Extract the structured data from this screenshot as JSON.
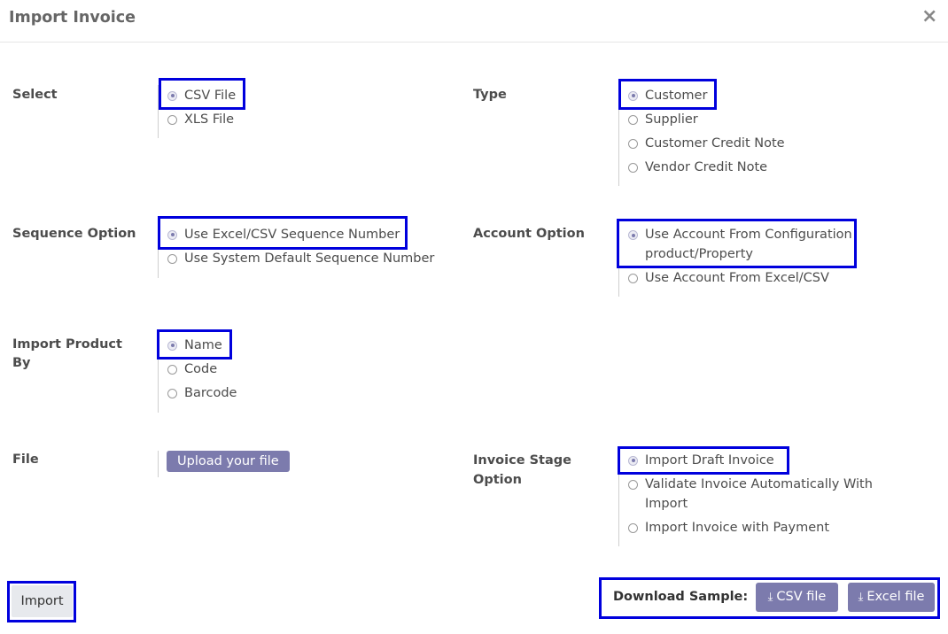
{
  "dialog": {
    "title": "Import Invoice",
    "close_glyph": "×"
  },
  "select": {
    "label": "Select",
    "options": [
      "CSV File",
      "XLS File"
    ],
    "selected": "CSV File"
  },
  "type": {
    "label": "Type",
    "options": [
      "Customer",
      "Supplier",
      "Customer Credit Note",
      "Vendor Credit Note"
    ],
    "selected": "Customer"
  },
  "sequence_option": {
    "label": "Sequence Option",
    "options": [
      "Use Excel/CSV Sequence Number",
      "Use System Default Sequence Number"
    ],
    "selected": "Use Excel/CSV Sequence Number"
  },
  "account_option": {
    "label": "Account Option",
    "options": [
      "Use Account From Configuration product/Property",
      "Use Account From Excel/CSV"
    ],
    "selected": "Use Account From Configuration product/Property"
  },
  "import_product_by": {
    "label": "Import Product By",
    "options": [
      "Name",
      "Code",
      "Barcode"
    ],
    "selected": "Name"
  },
  "file": {
    "label": "File",
    "upload_label": "Upload your file"
  },
  "invoice_stage_option": {
    "label": "Invoice Stage Option",
    "options": [
      "Import Draft Invoice",
      "Validate Invoice Automatically With Import",
      "Import Invoice with Payment"
    ],
    "selected": "Import Draft Invoice"
  },
  "footer": {
    "import_label": "Import",
    "download_sample_label": "Download Sample:",
    "csv_label": "CSV file",
    "excel_label": "Excel file",
    "download_icon": "download-icon"
  },
  "colors": {
    "primary": "#7c7bad",
    "highlight": "#0000dd",
    "secondary_button": "#e7e9ed"
  }
}
